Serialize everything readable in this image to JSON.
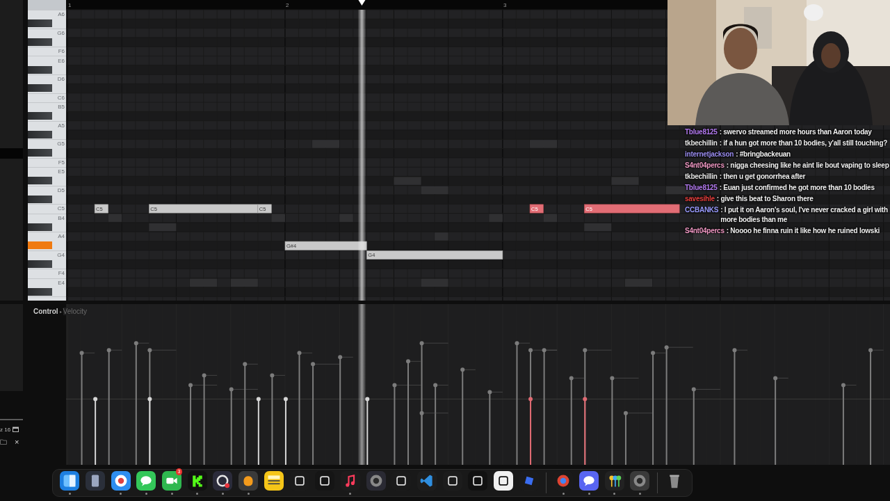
{
  "ruler": {
    "bars": [
      "1",
      "2",
      "3"
    ]
  },
  "playhead": {
    "level": 0.359
  },
  "keys": [
    {
      "kind": "white",
      "label": "A6",
      "pressed": false
    },
    {
      "kind": "black",
      "pressed": false
    },
    {
      "kind": "white",
      "label": "G6",
      "pressed": false
    },
    {
      "kind": "black",
      "pressed": false
    },
    {
      "kind": "white",
      "label": "F6",
      "pressed": false
    },
    {
      "kind": "white",
      "label": "E6",
      "pressed": false
    },
    {
      "kind": "black",
      "pressed": false
    },
    {
      "kind": "white",
      "label": "D6",
      "pressed": false
    },
    {
      "kind": "black",
      "pressed": false
    },
    {
      "kind": "white",
      "label": "C6",
      "pressed": false
    },
    {
      "kind": "white",
      "label": "B5",
      "pressed": false
    },
    {
      "kind": "black",
      "pressed": false
    },
    {
      "kind": "white",
      "label": "A5",
      "pressed": false
    },
    {
      "kind": "black",
      "pressed": false
    },
    {
      "kind": "white",
      "label": "G5",
      "pressed": false
    },
    {
      "kind": "black",
      "pressed": false
    },
    {
      "kind": "white",
      "label": "F5",
      "pressed": false
    },
    {
      "kind": "white",
      "label": "E5",
      "pressed": false
    },
    {
      "kind": "black",
      "pressed": false
    },
    {
      "kind": "white",
      "label": "D5",
      "pressed": false
    },
    {
      "kind": "black",
      "pressed": false
    },
    {
      "kind": "white",
      "label": "C5",
      "pressed": false,
      "notes": [
        {
          "label": "C5",
          "selected": false
        },
        {
          "label": "C5",
          "selected": false
        },
        {
          "label": "C5",
          "selected": false
        },
        {
          "label": "C5",
          "selected": true
        },
        {
          "label": "C5",
          "selected": true
        }
      ]
    },
    {
      "kind": "white",
      "label": "B4",
      "pressed": false
    },
    {
      "kind": "black",
      "pressed": false
    },
    {
      "kind": "white",
      "label": "A4",
      "pressed": false
    },
    {
      "kind": "black",
      "pressed": true,
      "notes": [
        {
          "label": "G#4",
          "selected": false
        }
      ]
    },
    {
      "kind": "white",
      "label": "G4",
      "pressed": false,
      "notes": [
        {
          "label": "G4",
          "selected": false
        }
      ]
    },
    {
      "kind": "black",
      "pressed": false
    },
    {
      "kind": "white",
      "label": "F4",
      "pressed": false
    },
    {
      "kind": "white",
      "label": "E4",
      "pressed": false
    },
    {
      "kind": "black",
      "pressed": false
    },
    {
      "kind": "white",
      "pressed": false
    }
  ],
  "control": {
    "label": "Control",
    "arrow": "▸",
    "target": "Velocity"
  },
  "left_panel": {
    "readout": "z 16",
    "close": "×"
  },
  "chat": [
    {
      "user": "Tblue8125",
      "color": "#b57cf2",
      "text": ": swervo streamed more hours than Aaron today"
    },
    {
      "user": "tkbechillin",
      "color": "#e8e8e8",
      "text": ": if a hun got more than 10 bodies, y'all still touching?"
    },
    {
      "user": "internetjackson",
      "color": "#9c8ef2",
      "text": ": #bringbackeuan"
    },
    {
      "user": "S4nt04percs",
      "color": "#f29ac6",
      "text": ": nigga cheesing like he aint lie bout vaping to sleep"
    },
    {
      "user": "tkbechillin",
      "color": "#e8e8e8",
      "text": ": then u get gonorrhea after"
    },
    {
      "user": "Tblue8125",
      "color": "#b57cf2",
      "text": ": Euan just confirmed he got more than 10 bodies"
    },
    {
      "user": "savesihle",
      "color": "#e8403e",
      "text": ": give this beat to Sharon there"
    },
    {
      "user": "CCBANKS",
      "color": "#9a9cff",
      "text": ": I put it on Aaron's soul, I've never cracked a girl with more bodies than me"
    },
    {
      "user": "S4nt04percs",
      "color": "#f29ac6",
      "text": ": Noooo he finna ruin it like how he ruined lowski"
    }
  ],
  "dock": [
    {
      "kind": "finder",
      "running": true
    },
    {
      "kind": "files",
      "running": false
    },
    {
      "kind": "safari",
      "running": true
    },
    {
      "kind": "messages",
      "running": true
    },
    {
      "kind": "facetime",
      "running": true,
      "badge": "3"
    },
    {
      "kind": "kick",
      "running": true
    },
    {
      "kind": "obs",
      "running": true
    },
    {
      "kind": "fl",
      "running": true
    },
    {
      "kind": "notes",
      "running": false
    },
    {
      "kind": "dark",
      "running": false
    },
    {
      "kind": "tv",
      "running": false
    },
    {
      "kind": "music",
      "running": true
    },
    {
      "kind": "resolve",
      "running": false
    },
    {
      "kind": "github",
      "running": false
    },
    {
      "kind": "vscode",
      "running": false
    },
    {
      "kind": "gpt",
      "running": false
    },
    {
      "kind": "capcut",
      "running": false
    },
    {
      "kind": "notion",
      "running": false
    },
    {
      "kind": "roblox",
      "running": false
    },
    {
      "kind": "divider"
    },
    {
      "kind": "chrome",
      "running": true
    },
    {
      "kind": "discord",
      "running": true
    },
    {
      "kind": "keys",
      "running": true
    },
    {
      "kind": "settings",
      "running": true
    },
    {
      "kind": "divider"
    },
    {
      "kind": "trash",
      "running": false
    }
  ]
}
